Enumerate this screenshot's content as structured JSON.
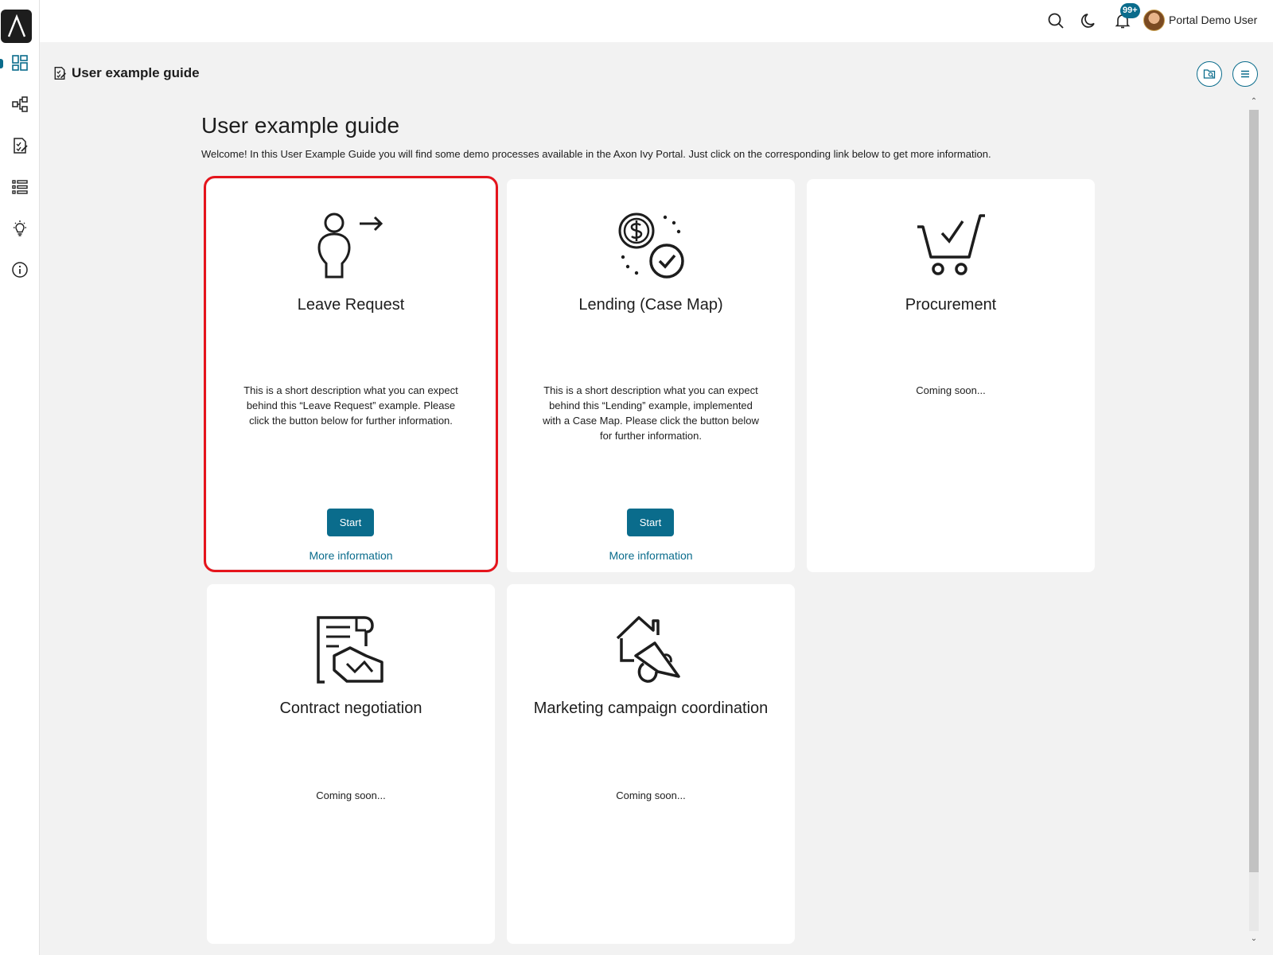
{
  "topbar": {
    "notification_count": "99+",
    "user_name": "Portal Demo User",
    "icons": [
      "search-icon",
      "moon-icon",
      "bell-icon",
      "avatar"
    ]
  },
  "sidebar": {
    "icons": [
      "dashboard-icon",
      "process-icon",
      "task-icon",
      "case-list-icon",
      "lightbulb-icon",
      "info-icon"
    ]
  },
  "page": {
    "header_title": "User example guide",
    "title": "User example guide",
    "description": "Welcome! In this User Example Guide you will find some demo processes available in the Axon Ivy Portal. Just click on the corresponding link below to get more information."
  },
  "cards": [
    {
      "title": "Leave Request",
      "description": "This is a short description what you can expect behind this “Leave Request” example. Please click the button below for further information.",
      "start_label": "Start",
      "more_label": "More information",
      "icon": "person-leave-icon"
    },
    {
      "title": "Lending (Case Map)",
      "description": "This is a short description what you can expect behind this “Lending” example, implemented with a Case Map. Please click the button below for further information.",
      "start_label": "Start",
      "more_label": "More information",
      "icon": "money-check-icon"
    },
    {
      "title": "Procurement",
      "description": "Coming soon...",
      "icon": "cart-check-icon"
    },
    {
      "title": "Contract negotiation",
      "description": "Coming soon...",
      "icon": "contract-handshake-icon"
    },
    {
      "title": "Marketing campaign coordination",
      "description": "Coming soon...",
      "icon": "house-megaphone-icon"
    }
  ],
  "colors": {
    "accent": "#0a6c8c",
    "highlight": "#e5141c",
    "background": "#f2f2f2"
  }
}
